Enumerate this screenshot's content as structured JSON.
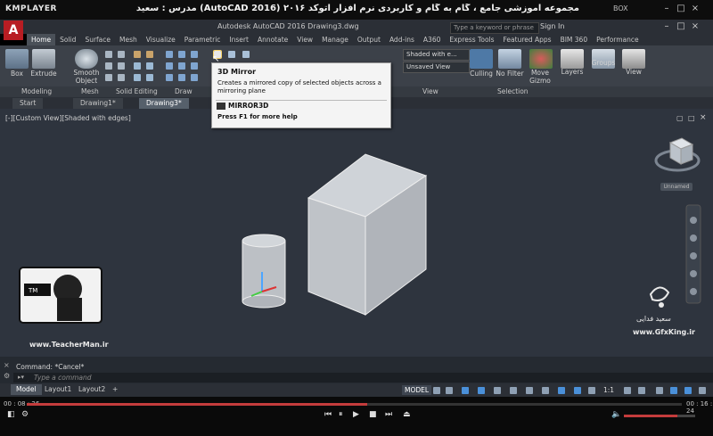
{
  "player": {
    "logo": "KMPLAYER",
    "title": "مجموعه آموزشی جامع ، گام به گام و کاربردی نرم افزار اتوکد ۲۰۱۶ (AutoCAD 2016) مدرس : سعید فدایی (تیچرمن) گروه آموزشی پادشاه گرافیست ها",
    "box_label": "BOX",
    "time_elapsed": "00 : 08 : 26",
    "time_total": "00 : 16 : 24",
    "progress": 0.52,
    "volume": 0.75
  },
  "app": {
    "logo": "A",
    "title": "Autodesk AutoCAD 2016    Drawing3.dwg",
    "search_placeholder": "Type a keyword or phrase",
    "signin": "Sign In"
  },
  "ribbon_tabs": [
    "Home",
    "Solid",
    "Surface",
    "Mesh",
    "Visualize",
    "Parametric",
    "Insert",
    "Annotate",
    "View",
    "Manage",
    "Output",
    "Add-ins",
    "A360",
    "Express Tools",
    "Featured Apps",
    "BIM 360",
    "Performance"
  ],
  "ribbon_active_tab": "Home",
  "ribbon": {
    "box": "Box",
    "extrude": "Extrude",
    "smooth_object": "Smooth Object",
    "culling": "Culling",
    "no_filter": "No Filter",
    "move_gizmo": "Move Gizmo",
    "layers": "Layers",
    "groups": "Groups",
    "view_btn": "View",
    "visual_style": "Shaded with e...",
    "saved_view": "Unsaved View",
    "panels": {
      "modeling": "Modeling",
      "mesh": "Mesh",
      "solid_editing": "Solid Editing",
      "draw": "Draw",
      "view": "View",
      "selection": "Selection"
    }
  },
  "doc_tabs": [
    "Start",
    "Drawing1*",
    "Drawing3*"
  ],
  "doc_active": "Drawing3*",
  "tooltip": {
    "title": "3D Mirror",
    "description": "Creates a mirrored copy of selected objects across a mirroring plane",
    "command": "MIRROR3D",
    "help": "Press F1 for more help"
  },
  "viewport": {
    "label": "[-][Custom View][Shaded with edges]",
    "unnamed": "Unnamed"
  },
  "command": {
    "history": "Command: *Cancel*",
    "placeholder": "Type a command"
  },
  "layout_tabs": [
    "Model",
    "Layout1",
    "Layout2",
    "+"
  ],
  "status": {
    "model": "MODEL",
    "zoom": "1:1"
  },
  "watermarks": {
    "teacher_url": "www.TeacherMan.ir",
    "gfx_url": "www.GfxKing.ir",
    "gfx_name": "سعید فدایی"
  },
  "colors": {
    "viewport_bg": "#2e343e",
    "ribbon_bg": "#3c4149",
    "accent_red": "#b81d23",
    "seek_red": "#c43c3c"
  }
}
